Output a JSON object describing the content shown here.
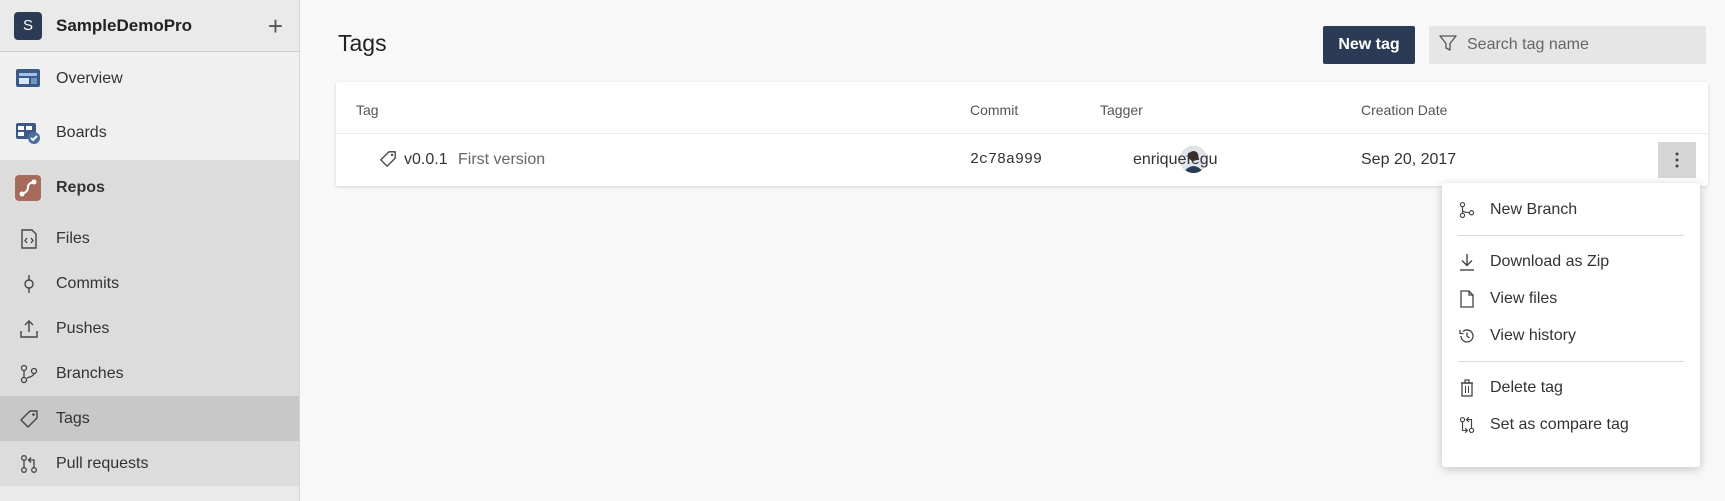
{
  "sidebar": {
    "project_initial": "S",
    "project_name": "SampleDemoPro",
    "add_label": "+",
    "items": [
      {
        "label": "Overview",
        "icon": "overview-icon"
      },
      {
        "label": "Boards",
        "icon": "boards-icon"
      },
      {
        "label": "Repos",
        "icon": "repos-icon"
      },
      {
        "label": "Files",
        "icon": "files-icon"
      },
      {
        "label": "Commits",
        "icon": "commits-icon"
      },
      {
        "label": "Pushes",
        "icon": "pushes-icon"
      },
      {
        "label": "Branches",
        "icon": "branches-icon"
      },
      {
        "label": "Tags",
        "icon": "tag-icon"
      },
      {
        "label": "Pull requests",
        "icon": "pull-request-icon"
      }
    ]
  },
  "header": {
    "title": "Tags",
    "new_tag_label": "New tag",
    "search_placeholder": "Search tag name"
  },
  "table": {
    "columns": [
      "Tag",
      "Commit",
      "Tagger",
      "Creation Date"
    ],
    "rows": [
      {
        "tag": "v0.0.1",
        "message": "First version",
        "commit": "2c78a999",
        "tagger": "enriquefegu",
        "date": "Sep 20, 2017"
      }
    ]
  },
  "menu": {
    "items": [
      {
        "label": "New Branch",
        "icon": "branch-icon"
      },
      {
        "label": "Download as Zip",
        "icon": "download-icon"
      },
      {
        "label": "View files",
        "icon": "file-icon"
      },
      {
        "label": "View history",
        "icon": "history-icon"
      },
      {
        "label": "Delete tag",
        "icon": "trash-icon"
      },
      {
        "label": "Set as compare tag",
        "icon": "compare-icon"
      }
    ]
  },
  "colors": {
    "accent": "#2b3a55",
    "sidebar_bg": "#eaeaea",
    "selected": "#c8c8c8"
  }
}
